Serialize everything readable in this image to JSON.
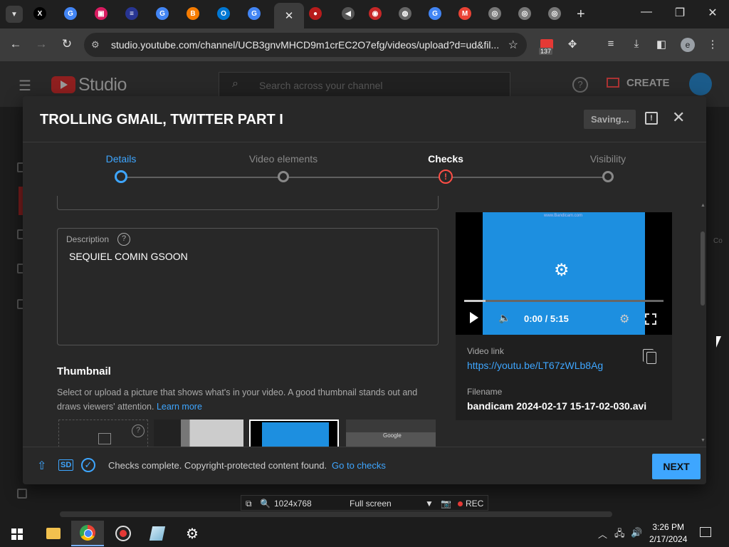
{
  "browser": {
    "tabs": [
      {
        "icon": "x-twitter-icon",
        "glyph": "X",
        "color": "#000000"
      },
      {
        "icon": "google-icon",
        "glyph": "G",
        "color": "#4285f4"
      },
      {
        "icon": "red-app-icon",
        "glyph": "▣",
        "color": "#d81b60"
      },
      {
        "icon": "blue-app-icon",
        "glyph": "≡",
        "color": "#283593"
      },
      {
        "icon": "google-icon",
        "glyph": "G",
        "color": "#4285f4"
      },
      {
        "icon": "blogger-icon",
        "glyph": "B",
        "color": "#f57c00"
      },
      {
        "icon": "outlook-icon",
        "glyph": "O",
        "color": "#0078d4"
      },
      {
        "icon": "google-icon",
        "glyph": "G",
        "color": "#4285f4"
      }
    ],
    "tabs_right": [
      {
        "icon": "record-icon",
        "glyph": "●",
        "color": "#b71c1c"
      },
      {
        "icon": "speaker-icon",
        "glyph": "◀",
        "color": "#555555"
      },
      {
        "icon": "record-icon",
        "glyph": "◉",
        "color": "#c62828"
      },
      {
        "icon": "globe-icon",
        "glyph": "◍",
        "color": "#666666"
      },
      {
        "icon": "google-icon",
        "glyph": "G",
        "color": "#4285f4"
      },
      {
        "icon": "gmail-icon",
        "glyph": "M",
        "color": "#ea4335"
      },
      {
        "icon": "chrome-icon",
        "glyph": "◎",
        "color": "#777777"
      },
      {
        "icon": "chrome-icon",
        "glyph": "◎",
        "color": "#777777"
      },
      {
        "icon": "chrome-icon",
        "glyph": "◎",
        "color": "#777777"
      }
    ],
    "active_tab_close": "✕",
    "new_tab": "+",
    "url": "studio.youtube.com/channel/UCB3gnvMHCD9m1crEC2O7efg/videos/upload?d=ud&fil...",
    "ext_badge_count": "137",
    "profile_initial": "e"
  },
  "studio": {
    "logo_text": "Studio",
    "search_placeholder": "Search across your channel",
    "create_label": "CREATE"
  },
  "dialog": {
    "title": "TROLLING GMAIL, TWITTER PART I",
    "saving_label": "Saving...",
    "steps": [
      {
        "label": "Details",
        "state": "active"
      },
      {
        "label": "Video elements",
        "state": "pending"
      },
      {
        "label": "Checks",
        "state": "warning"
      },
      {
        "label": "Visibility",
        "state": "pending"
      }
    ],
    "description": {
      "label": "Description",
      "value": "SEQUIEL COMIN GSOON"
    },
    "thumbnail": {
      "heading": "Thumbnail",
      "text": "Select or upload a picture that shows what's in your video. A good thumbnail stands out and draws viewers' attention.",
      "learn_more": "Learn more",
      "google_label": "Google"
    },
    "video": {
      "watermark": "www.Bandicam.com",
      "time": "0:00 / 5:15",
      "link_label": "Video link",
      "link": "https://youtu.be/LT67zWLb8Ag",
      "filename_label": "Filename",
      "filename": "bandicam 2024-02-17 15-17-02-030.avi"
    },
    "footer": {
      "sd_label": "SD",
      "status": "Checks complete. Copyright-protected content found.",
      "go_to_checks": "Go to checks",
      "next_label": "NEXT"
    }
  },
  "bandicam": {
    "resolution": "1024x768",
    "mode": "Full screen",
    "rec_label": "REC"
  },
  "taskbar": {
    "time": "3:26 PM",
    "date": "2/17/2024"
  },
  "colors": {
    "accent": "#3ea6ff",
    "warning": "#ff4e45"
  }
}
